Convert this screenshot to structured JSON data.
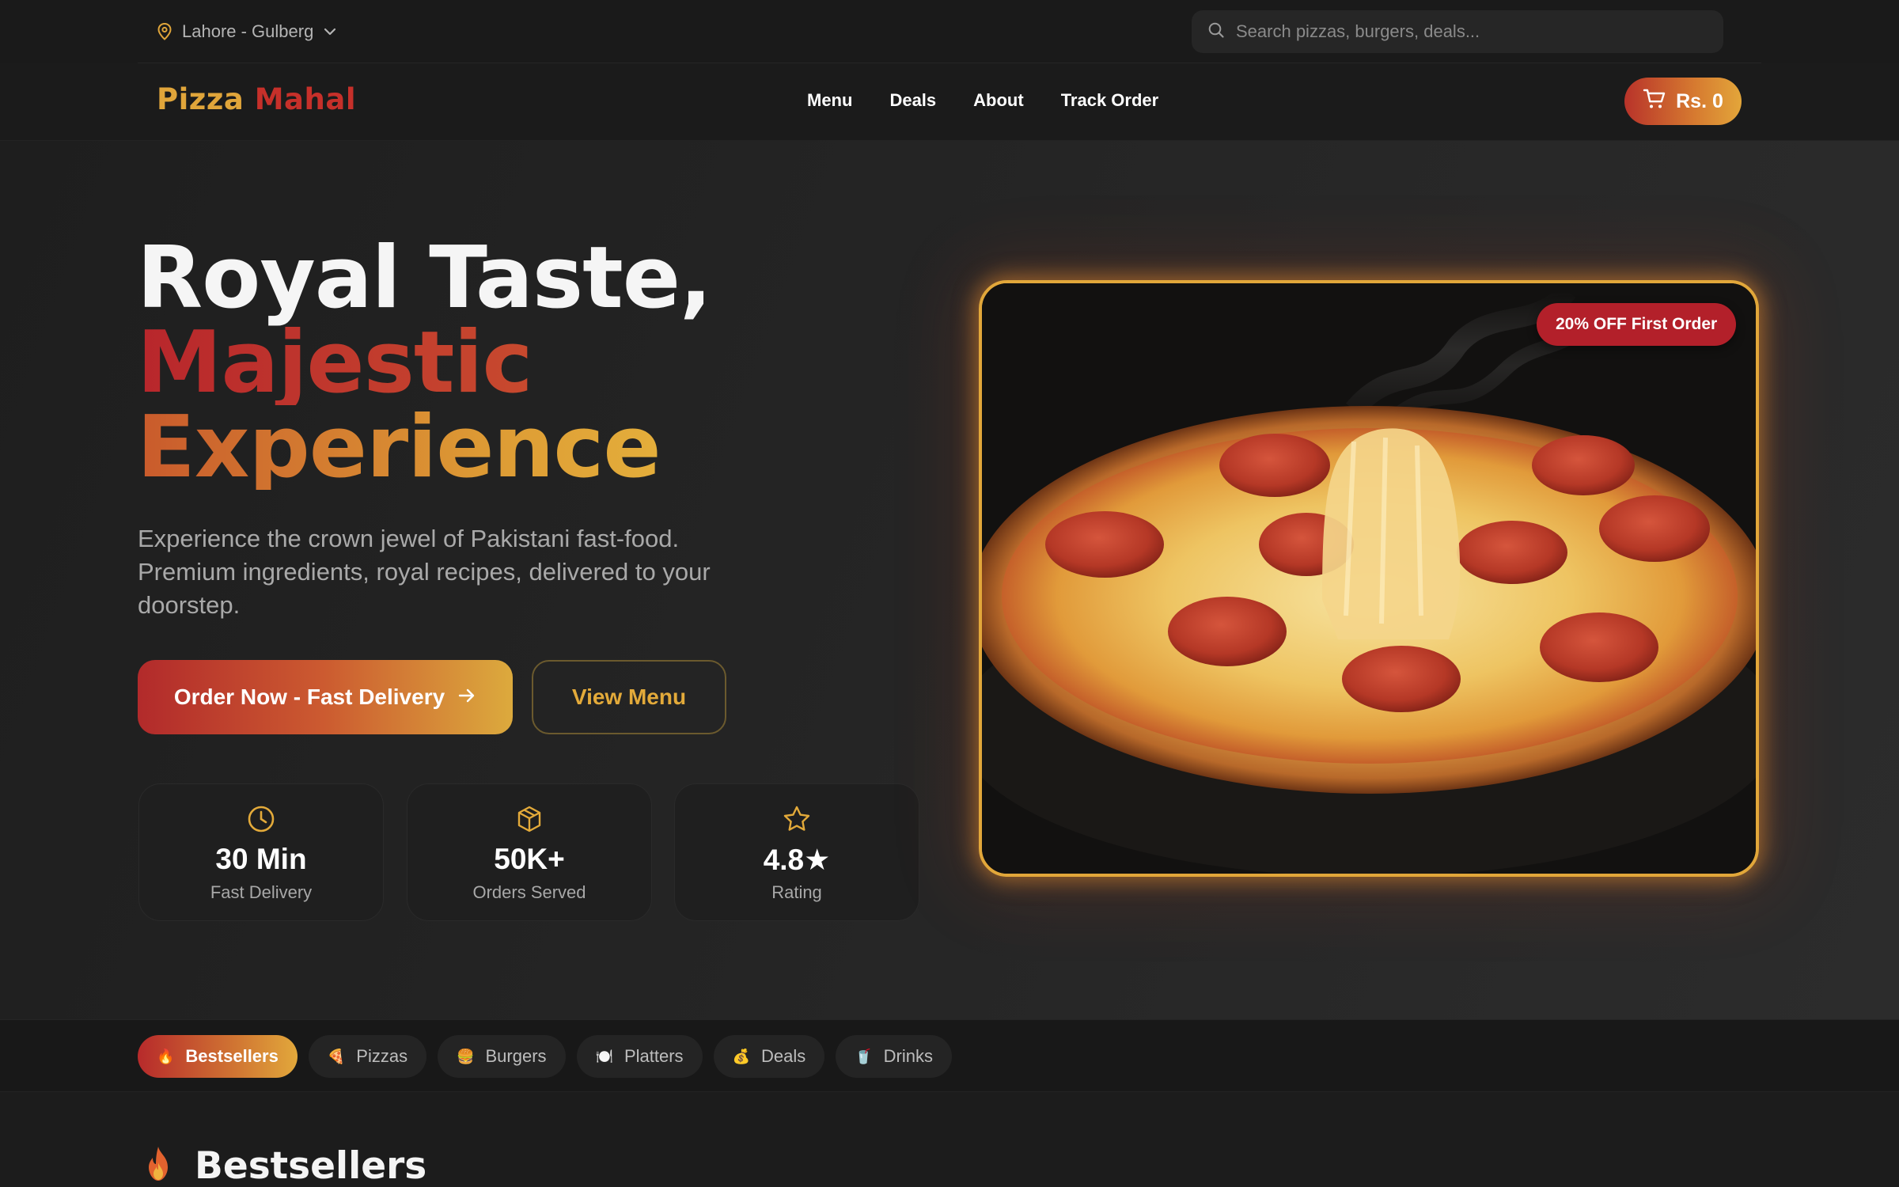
{
  "topbar": {
    "location": "Lahore - Gulberg",
    "location_icon": "map-pin-icon",
    "search_placeholder": "Search pizzas, burgers, deals..."
  },
  "nav": {
    "logo_part1": "Pizza",
    "logo_part2": "Mahal",
    "links": [
      "Menu",
      "Deals",
      "About",
      "Track Order"
    ],
    "cart_label": "Rs. 0"
  },
  "hero": {
    "line1": "Royal Taste,",
    "line2": "Majestic",
    "line3": "Experience",
    "subtext": "Experience the crown jewel of Pakistani fast-food. Premium ingredients, royal recipes, delivered to your doorstep.",
    "order_button": "Order Now - Fast Delivery",
    "view_button": "View Menu",
    "promo_badge": "20% OFF First Order",
    "stats": [
      {
        "value": "30 Min",
        "label": "Fast Delivery",
        "icon": "clock-icon"
      },
      {
        "value": "50K+",
        "label": "Orders Served",
        "icon": "box-icon"
      },
      {
        "value": "4.8★",
        "label": "Rating",
        "icon": "star-icon"
      }
    ]
  },
  "categories": [
    {
      "label": "Bestsellers",
      "emoji": "🔥",
      "active": true
    },
    {
      "label": "Pizzas",
      "emoji": "🍕",
      "active": false
    },
    {
      "label": "Burgers",
      "emoji": "🍔",
      "active": false
    },
    {
      "label": "Platters",
      "emoji": "🍽️",
      "active": false
    },
    {
      "label": "Deals",
      "emoji": "💰",
      "active": false
    },
    {
      "label": "Drinks",
      "emoji": "🥤",
      "active": false
    }
  ],
  "section": {
    "title": "Bestsellers",
    "emoji": "🔥"
  },
  "colors": {
    "gold": "#e3aa3a",
    "red": "#c6302a",
    "background": "#1c1c1c"
  }
}
